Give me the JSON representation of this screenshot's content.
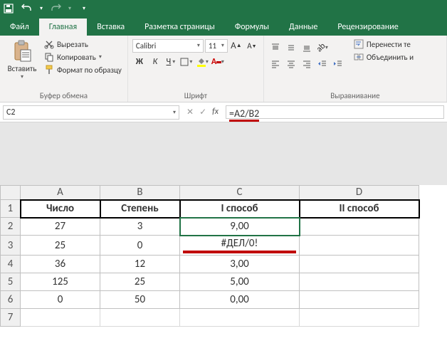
{
  "qat": {
    "save": "save-icon",
    "undo": "undo-icon",
    "redo": "redo-icon"
  },
  "tabs": {
    "file": "Файл",
    "home": "Главная",
    "insert": "Вставка",
    "layout": "Разметка страницы",
    "formulas": "Формулы",
    "data": "Данные",
    "review": "Рецензирование"
  },
  "ribbon": {
    "clipboard": {
      "paste": "Вставить",
      "cut": "Вырезать",
      "copy": "Копировать",
      "format_painter": "Формат по образцу",
      "group_label": "Буфер обмена"
    },
    "font": {
      "name": "Calibri",
      "size": "11",
      "bold": "Ж",
      "italic": "К",
      "underline": "Ч",
      "group_label": "Шрифт"
    },
    "alignment": {
      "wrap": "Перенести те",
      "merge": "Объединить и",
      "group_label": "Выравнивание"
    }
  },
  "namebox": "C2",
  "formula": "=A2/B2",
  "fx_label": "fx",
  "columns": [
    "A",
    "B",
    "C",
    "D"
  ],
  "headers": {
    "a": "Число",
    "b": "Степень",
    "c": "I способ",
    "d": "II способ"
  },
  "rows": [
    {
      "n": "2",
      "a": "27",
      "b": "3",
      "c": "9,00",
      "d": ""
    },
    {
      "n": "3",
      "a": "25",
      "b": "0",
      "c": "#ДЕЛ/0!",
      "d": ""
    },
    {
      "n": "4",
      "a": "36",
      "b": "12",
      "c": "3,00",
      "d": ""
    },
    {
      "n": "5",
      "a": "125",
      "b": "25",
      "c": "5,00",
      "d": ""
    },
    {
      "n": "6",
      "a": "0",
      "b": "50",
      "c": "0,00",
      "d": ""
    },
    {
      "n": "7",
      "a": "",
      "b": "",
      "c": "",
      "d": ""
    }
  ],
  "chart_data": {
    "type": "table",
    "columns": [
      "Число",
      "Степень",
      "I способ",
      "II способ"
    ],
    "rows": [
      [
        27,
        3,
        9.0,
        null
      ],
      [
        25,
        0,
        "#ДЕЛ/0!",
        null
      ],
      [
        36,
        12,
        3.0,
        null
      ],
      [
        125,
        25,
        5.0,
        null
      ],
      [
        0,
        50,
        0.0,
        null
      ]
    ],
    "formula_C2": "=A2/B2",
    "selected_cell": "C2",
    "error_cell": "C3"
  }
}
